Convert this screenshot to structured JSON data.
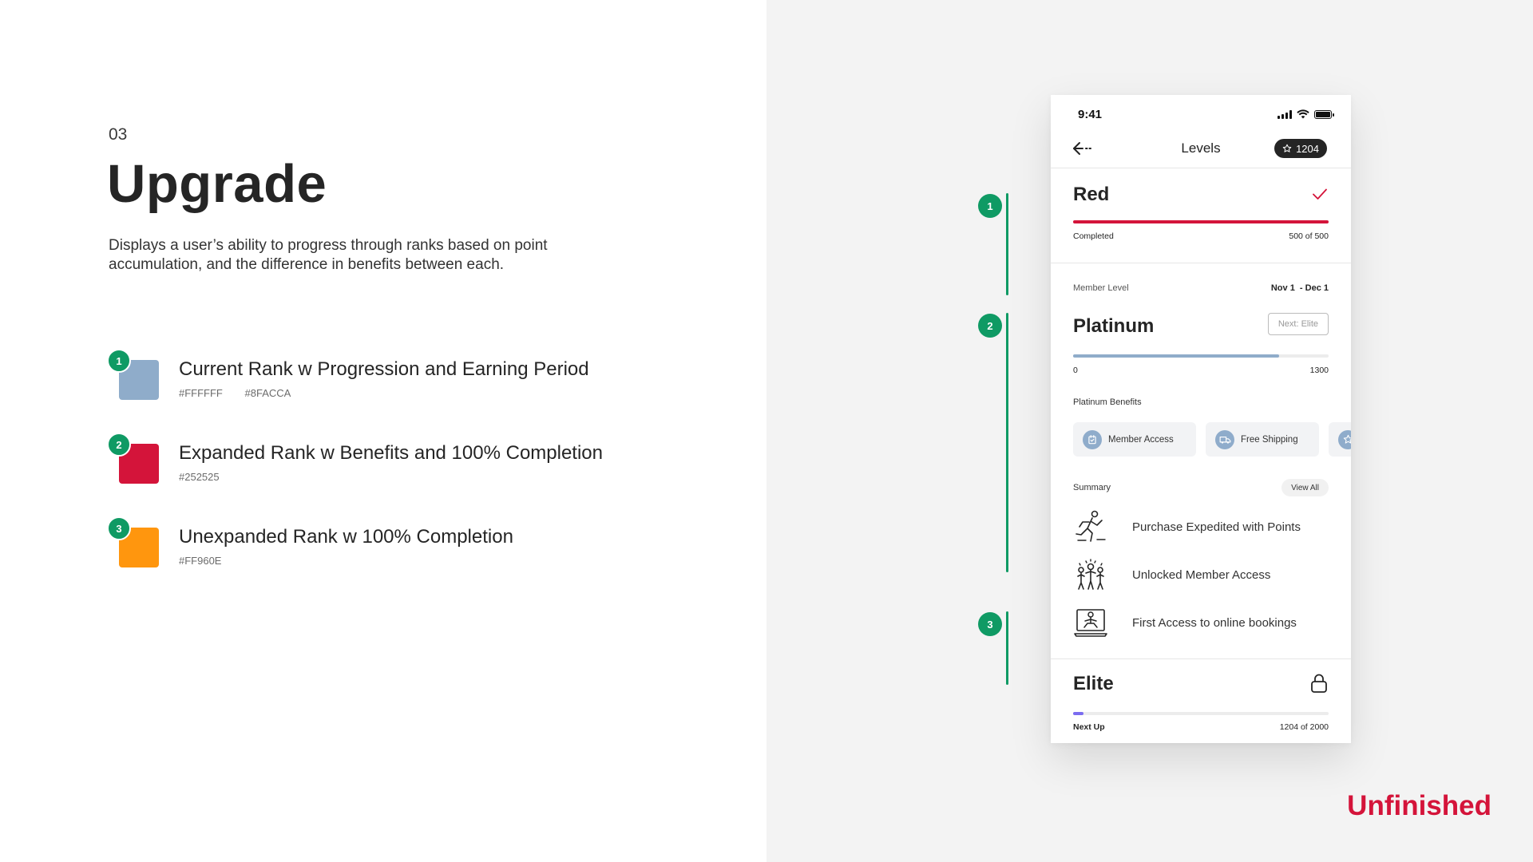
{
  "page": {
    "section_number": "03",
    "title": "Upgrade",
    "description": "Displays a user’s ability to progress through ranks based on point accumulation, and the difference in benefits between each.",
    "brand": "Unfinished",
    "brand_color": "#d4143a"
  },
  "legend": [
    {
      "number": "1",
      "title": "Current Rank w Progression and Earning Period",
      "codes": [
        "#FFFFFF",
        "#8FACCA"
      ],
      "swatch_color": "#8facca"
    },
    {
      "number": "2",
      "title": "Expanded Rank w Benefits and 100% Completion",
      "codes": [
        "#252525"
      ],
      "swatch_color": "#d4143a"
    },
    {
      "number": "3",
      "title": "Unexpanded Rank w 100% Completion",
      "codes": [
        "#FF960E"
      ],
      "swatch_color": "#ff960e"
    }
  ],
  "timeline": {
    "labels": [
      "1",
      "2",
      "3"
    ],
    "color": "#0f9a64"
  },
  "phone": {
    "status_time": "9:41",
    "nav_title": "Levels",
    "points": "1204",
    "icons": {
      "back": "back-arrow-icon",
      "star": "star-icon",
      "check": "check-icon",
      "lock": "lock-icon"
    },
    "red_rank": {
      "name": "Red",
      "status": "Completed",
      "count": "500 of 500",
      "progress": 1.0,
      "color": "#d4143a"
    },
    "member_level": {
      "label": "Member Level",
      "period": "Nov 1  - Dec 1",
      "name": "Platinum",
      "next_button": "Next: Elite",
      "min": "0",
      "max": "1300",
      "progress": 0.805,
      "bar_color": "#8facca"
    },
    "benefits": {
      "label": "Platinum Benefits",
      "items": [
        {
          "label": "Member Access",
          "icon": "member-card-icon"
        },
        {
          "label": "Free Shipping",
          "icon": "truck-icon"
        },
        {
          "label": "",
          "icon": "star-icon"
        }
      ]
    },
    "summary": {
      "label": "Summary",
      "view_all": "View All",
      "items": [
        {
          "text": "Purchase Expedited with Points",
          "icon": "running-person-icon"
        },
        {
          "text": "Unlocked Member Access",
          "icon": "group-people-icon"
        },
        {
          "text": "First Access to online bookings",
          "icon": "laptop-person-icon"
        }
      ]
    },
    "elite_rank": {
      "name": "Elite",
      "status": "Next Up",
      "count": "1204 of 2000",
      "progress": 0.04,
      "color": "#7b6cf0"
    }
  }
}
